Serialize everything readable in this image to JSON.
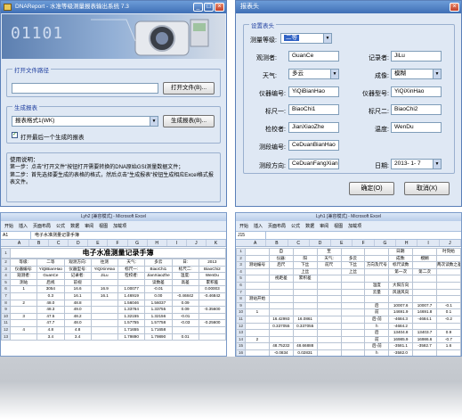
{
  "window1": {
    "title": "DNAReport - 水准等级测量报表输出系统 7.3",
    "banner_digits": "01101",
    "open_group_label": "打开文件路径",
    "file_path_value": "",
    "open_button": "打开文件(B)...",
    "gen_group_label": "生成报表",
    "format_select_value": "报表格式1(WK)",
    "gen_button": "生成报表(B)...",
    "open_after_checkbox": "打开最后一个生成的报表",
    "open_after_checked": true,
    "usage_title": "使用说明：",
    "usage_step1": "第一步：点击\"打开文件\"按钮打开需要转换的DNA原始GSI测量数据文件；",
    "usage_step2": "第二步：首先选择要生成的表格的格式，然后点击\"生成报表\"按钮生成相应Excel格式报表文件。"
  },
  "window2": {
    "title": "报表头",
    "group_label": "设置表头",
    "fields": {
      "level_label": "测量等级:",
      "level_value": "二等",
      "observer_label": "观测者:",
      "observer_value": "GuanCe",
      "recorder_label": "记录者:",
      "recorder_value": "JiLu",
      "weather_label": "天气:",
      "weather_value": "多云",
      "imaging_label": "成像:",
      "imaging_value": "模糊",
      "instr_no_label": "仪器编号:",
      "instr_no_value": "YiQiBianHao",
      "instr_model_label": "仪器型号:",
      "instr_model_value": "YiQiXinHao",
      "rod1_label": "标尺一:",
      "rod1_value": "BiaoChi1",
      "rod2_label": "标尺二:",
      "rod2_value": "BiaoChi2",
      "checker_label": "检校者:",
      "checker_value": "JianXiaoZhe",
      "temp_label": "温度:",
      "temp_value": "WenDu",
      "sec_no_label": "测段编号:",
      "sec_no_value": "CeDuanBianHao",
      "sec_dir_label": "测段方向:",
      "sec_dir_value": "CeDuanFangXian",
      "date_label": "日期:",
      "date_value": "2013-  1-  7"
    },
    "ok_button": "确定(O)",
    "cancel_button": "取消(X)"
  },
  "excel_left": {
    "title": "Lyh2 [兼容模式] - Microsoft Excel",
    "ribbon": [
      "开始",
      "插入",
      "页面布局",
      "公式",
      "数据",
      "审阅",
      "视图",
      "加载项"
    ],
    "namebox": "A1",
    "formula": "电子水准测量记录手簿",
    "columns": [
      "A",
      "B",
      "C",
      "D",
      "E",
      "F",
      "G",
      "H",
      "I",
      "J",
      "K"
    ],
    "sheet_title": "电子水准测量记录手簿",
    "rows": [
      [
        "等级:",
        "二等",
        "观测方向:",
        "往测",
        "天气:",
        "多云",
        "日:",
        "2013"
      ],
      [
        "仪器编号:",
        "YiQiBianHao",
        "仪器型号:",
        "YiQiXinHao",
        "标尺一:",
        "BiaoChi1",
        "标尺二:",
        "BiaoChi2"
      ],
      [
        "观测者:",
        "GuanCe",
        "记录者:",
        "JiLu",
        "检校者:",
        "JianXiaoZhe",
        "温度:",
        "WenDu"
      ],
      [
        "测站",
        "后视",
        "前视",
        "",
        "",
        "读数差",
        "高差",
        "累积差"
      ],
      [
        "1",
        "3054",
        "16.6",
        "16.9",
        "1.00077",
        "-0.01",
        "",
        "0.00003"
      ],
      [
        "",
        "0.3",
        "16.1",
        "16.1",
        "1.46919",
        "0.00",
        "-0.46842",
        "-0.46842"
      ],
      [
        "2",
        "48.0",
        "48.8",
        "",
        "1.56046",
        "1.56037",
        "0.09",
        ""
      ],
      [
        "",
        "48.3",
        "49.0",
        "",
        "1.33764",
        "1.33755",
        "0.09",
        "-0.35600"
      ],
      [
        "3",
        "47.5",
        "48.2",
        "",
        "1.32155",
        "1.32156",
        "-0.01",
        ""
      ],
      [
        "",
        "47.7",
        "48.0",
        "",
        "1.57755",
        "1.57758",
        "-0.03",
        "-0.25600"
      ],
      [
        "4",
        "4.8",
        "4.8",
        "",
        "1.71655",
        "1.71658",
        "",
        ""
      ],
      [
        "",
        "3.4",
        "3.4",
        "",
        "1.79890",
        "1.79890",
        "0.01",
        ""
      ]
    ]
  },
  "excel_right": {
    "title": "Lyh1 [兼容模式] - Microsoft Excel",
    "ribbon": [
      "开始",
      "插入",
      "页面布局",
      "公式",
      "数据",
      "审阅",
      "视图",
      "加载项"
    ],
    "namebox": "J15",
    "formula": "",
    "columns": [
      "A",
      "B",
      "C",
      "D",
      "E",
      "F",
      "G",
      "H",
      "I",
      "J"
    ],
    "rows": [
      [
        "",
        "自",
        "",
        "至",
        "",
        "",
        "日期:",
        "",
        "时刻始"
      ],
      [
        "",
        "仪器:",
        "阳",
        "天气:",
        "多云",
        "",
        "成像:",
        "模糊",
        ""
      ],
      [
        "测站编号",
        "后尺",
        "下丝",
        "前尺",
        "下丝",
        "方向及尺号",
        "标尺读数",
        "",
        "两次读数之差"
      ],
      [
        "",
        "",
        "上丝",
        "",
        "上丝",
        "",
        "第一次",
        "第二次",
        ""
      ],
      [
        "",
        "视距差",
        "累积差",
        "",
        "",
        "",
        "",
        "",
        ""
      ],
      [
        "",
        "",
        "",
        "",
        "",
        "温度",
        "大阳方向",
        "",
        ""
      ],
      [
        "",
        "",
        "",
        "",
        "",
        "云量",
        "风速风向",
        "",
        ""
      ],
      [
        "测站开始",
        "",
        "",
        "",
        "",
        "",
        "",
        "",
        ""
      ],
      [
        "",
        "",
        "",
        "",
        "",
        "后",
        "10007.6",
        "10007.7",
        "-0.1"
      ],
      [
        "1",
        "",
        "",
        "",
        "",
        "前",
        "14691.9",
        "14691.8",
        "0.1"
      ],
      [
        "",
        "16.42993",
        "16.0861",
        "",
        "",
        "后-前",
        "-4684.3",
        "-4684.1",
        "-0.2"
      ],
      [
        "",
        "0.337055",
        "0.337055",
        "",
        "",
        "h",
        "-4684.2",
        "",
        ""
      ],
      [
        "",
        "",
        "",
        "",
        "",
        "后",
        "13404.8",
        "13403.7",
        "0.9"
      ],
      [
        "2",
        "",
        "",
        "",
        "",
        "前",
        "16985.9",
        "16986.6",
        "-0.7"
      ],
      [
        "",
        "48.75232",
        "48.66888",
        "",
        "",
        "后-前",
        "-3581.1",
        "-3582.7",
        "1.6"
      ],
      [
        "",
        "-0.0834",
        "0.02831",
        "",
        "",
        "h",
        "-3582.0",
        "",
        ""
      ]
    ]
  }
}
